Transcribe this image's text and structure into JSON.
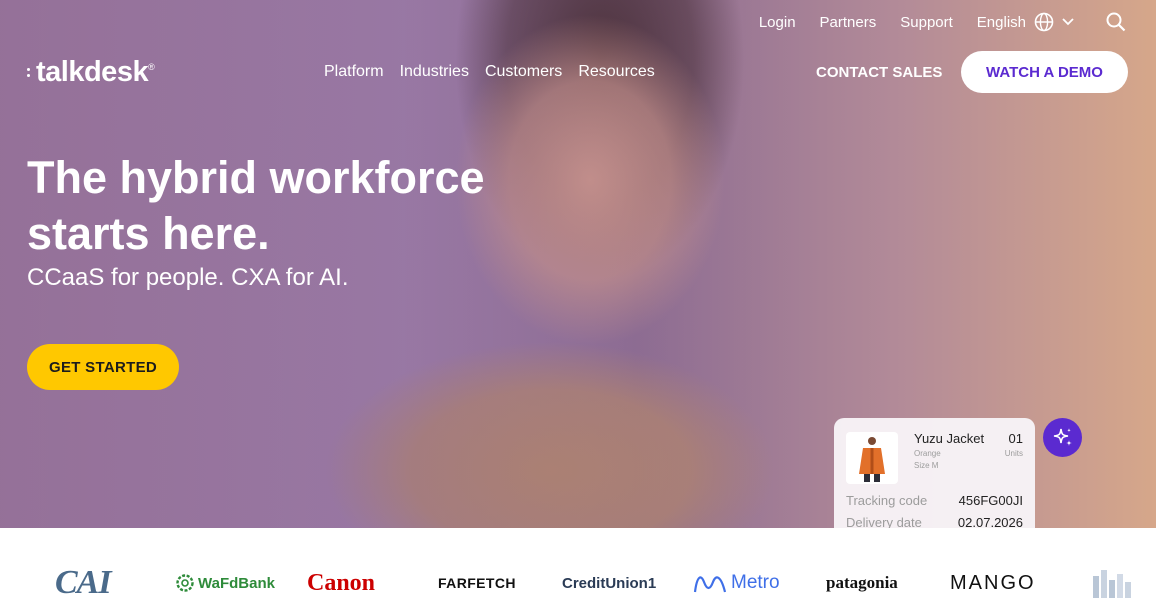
{
  "util_nav": {
    "login": "Login",
    "partners": "Partners",
    "support": "Support",
    "language": "English"
  },
  "logo": "talkdesk",
  "main_nav": [
    "Platform",
    "Industries",
    "Customers",
    "Resources"
  ],
  "contact_sales": "CONTACT SALES",
  "watch_demo": "WATCH A DEMO",
  "hero": {
    "headline": "The hybrid workforce starts here.",
    "subheadline": "CCaaS for people. CXA for AI.",
    "cta": "GET STARTED"
  },
  "order_card": {
    "product": "Yuzu Jacket",
    "qty": "01",
    "qty_unit": "Units",
    "color": "Orange",
    "size": "Size M",
    "tracking_label": "Tracking code",
    "tracking_value": "456FG00JI",
    "delivery_label": "Delivery date",
    "delivery_value": "02.07.2026"
  },
  "customer_logos": [
    "CAI",
    "WaFdBank",
    "Canon",
    "FARFETCH",
    "CreditUnion1",
    "Metro",
    "patagonia",
    "MANGO"
  ],
  "colors": {
    "accent_purple": "#5b2ad0",
    "cta_yellow": "#ffc800",
    "canon_red": "#cc0000",
    "metro_blue": "#3f6fe8",
    "wafd_green": "#2e8b3a"
  },
  "icons": [
    "globe-icon",
    "chevron-down-icon",
    "search-icon",
    "sparkle-icon"
  ]
}
